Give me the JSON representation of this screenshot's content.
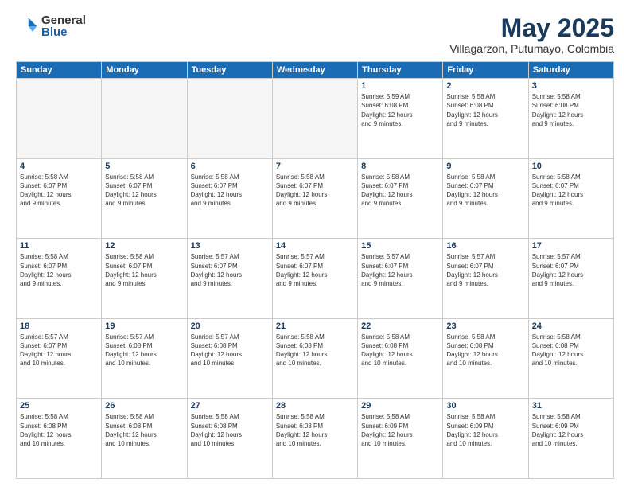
{
  "logo": {
    "general": "General",
    "blue": "Blue"
  },
  "title": "May 2025",
  "subtitle": "Villagarzon, Putumayo, Colombia",
  "headers": [
    "Sunday",
    "Monday",
    "Tuesday",
    "Wednesday",
    "Thursday",
    "Friday",
    "Saturday"
  ],
  "weeks": [
    [
      {
        "day": "",
        "info": "",
        "empty": true
      },
      {
        "day": "",
        "info": "",
        "empty": true
      },
      {
        "day": "",
        "info": "",
        "empty": true
      },
      {
        "day": "",
        "info": "",
        "empty": true
      },
      {
        "day": "1",
        "info": "Sunrise: 5:59 AM\nSunset: 6:08 PM\nDaylight: 12 hours\nand 9 minutes.",
        "empty": false
      },
      {
        "day": "2",
        "info": "Sunrise: 5:58 AM\nSunset: 6:08 PM\nDaylight: 12 hours\nand 9 minutes.",
        "empty": false
      },
      {
        "day": "3",
        "info": "Sunrise: 5:58 AM\nSunset: 6:08 PM\nDaylight: 12 hours\nand 9 minutes.",
        "empty": false
      }
    ],
    [
      {
        "day": "4",
        "info": "Sunrise: 5:58 AM\nSunset: 6:07 PM\nDaylight: 12 hours\nand 9 minutes.",
        "empty": false
      },
      {
        "day": "5",
        "info": "Sunrise: 5:58 AM\nSunset: 6:07 PM\nDaylight: 12 hours\nand 9 minutes.",
        "empty": false
      },
      {
        "day": "6",
        "info": "Sunrise: 5:58 AM\nSunset: 6:07 PM\nDaylight: 12 hours\nand 9 minutes.",
        "empty": false
      },
      {
        "day": "7",
        "info": "Sunrise: 5:58 AM\nSunset: 6:07 PM\nDaylight: 12 hours\nand 9 minutes.",
        "empty": false
      },
      {
        "day": "8",
        "info": "Sunrise: 5:58 AM\nSunset: 6:07 PM\nDaylight: 12 hours\nand 9 minutes.",
        "empty": false
      },
      {
        "day": "9",
        "info": "Sunrise: 5:58 AM\nSunset: 6:07 PM\nDaylight: 12 hours\nand 9 minutes.",
        "empty": false
      },
      {
        "day": "10",
        "info": "Sunrise: 5:58 AM\nSunset: 6:07 PM\nDaylight: 12 hours\nand 9 minutes.",
        "empty": false
      }
    ],
    [
      {
        "day": "11",
        "info": "Sunrise: 5:58 AM\nSunset: 6:07 PM\nDaylight: 12 hours\nand 9 minutes.",
        "empty": false
      },
      {
        "day": "12",
        "info": "Sunrise: 5:58 AM\nSunset: 6:07 PM\nDaylight: 12 hours\nand 9 minutes.",
        "empty": false
      },
      {
        "day": "13",
        "info": "Sunrise: 5:57 AM\nSunset: 6:07 PM\nDaylight: 12 hours\nand 9 minutes.",
        "empty": false
      },
      {
        "day": "14",
        "info": "Sunrise: 5:57 AM\nSunset: 6:07 PM\nDaylight: 12 hours\nand 9 minutes.",
        "empty": false
      },
      {
        "day": "15",
        "info": "Sunrise: 5:57 AM\nSunset: 6:07 PM\nDaylight: 12 hours\nand 9 minutes.",
        "empty": false
      },
      {
        "day": "16",
        "info": "Sunrise: 5:57 AM\nSunset: 6:07 PM\nDaylight: 12 hours\nand 9 minutes.",
        "empty": false
      },
      {
        "day": "17",
        "info": "Sunrise: 5:57 AM\nSunset: 6:07 PM\nDaylight: 12 hours\nand 9 minutes.",
        "empty": false
      }
    ],
    [
      {
        "day": "18",
        "info": "Sunrise: 5:57 AM\nSunset: 6:07 PM\nDaylight: 12 hours\nand 10 minutes.",
        "empty": false
      },
      {
        "day": "19",
        "info": "Sunrise: 5:57 AM\nSunset: 6:08 PM\nDaylight: 12 hours\nand 10 minutes.",
        "empty": false
      },
      {
        "day": "20",
        "info": "Sunrise: 5:57 AM\nSunset: 6:08 PM\nDaylight: 12 hours\nand 10 minutes.",
        "empty": false
      },
      {
        "day": "21",
        "info": "Sunrise: 5:58 AM\nSunset: 6:08 PM\nDaylight: 12 hours\nand 10 minutes.",
        "empty": false
      },
      {
        "day": "22",
        "info": "Sunrise: 5:58 AM\nSunset: 6:08 PM\nDaylight: 12 hours\nand 10 minutes.",
        "empty": false
      },
      {
        "day": "23",
        "info": "Sunrise: 5:58 AM\nSunset: 6:08 PM\nDaylight: 12 hours\nand 10 minutes.",
        "empty": false
      },
      {
        "day": "24",
        "info": "Sunrise: 5:58 AM\nSunset: 6:08 PM\nDaylight: 12 hours\nand 10 minutes.",
        "empty": false
      }
    ],
    [
      {
        "day": "25",
        "info": "Sunrise: 5:58 AM\nSunset: 6:08 PM\nDaylight: 12 hours\nand 10 minutes.",
        "empty": false
      },
      {
        "day": "26",
        "info": "Sunrise: 5:58 AM\nSunset: 6:08 PM\nDaylight: 12 hours\nand 10 minutes.",
        "empty": false
      },
      {
        "day": "27",
        "info": "Sunrise: 5:58 AM\nSunset: 6:08 PM\nDaylight: 12 hours\nand 10 minutes.",
        "empty": false
      },
      {
        "day": "28",
        "info": "Sunrise: 5:58 AM\nSunset: 6:08 PM\nDaylight: 12 hours\nand 10 minutes.",
        "empty": false
      },
      {
        "day": "29",
        "info": "Sunrise: 5:58 AM\nSunset: 6:09 PM\nDaylight: 12 hours\nand 10 minutes.",
        "empty": false
      },
      {
        "day": "30",
        "info": "Sunrise: 5:58 AM\nSunset: 6:09 PM\nDaylight: 12 hours\nand 10 minutes.",
        "empty": false
      },
      {
        "day": "31",
        "info": "Sunrise: 5:58 AM\nSunset: 6:09 PM\nDaylight: 12 hours\nand 10 minutes.",
        "empty": false
      }
    ]
  ]
}
